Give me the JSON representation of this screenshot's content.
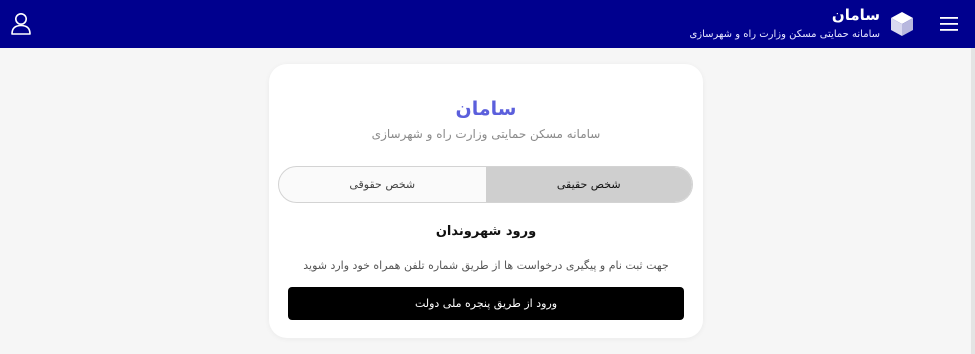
{
  "header": {
    "title": "سامان",
    "subtitle": "سامانه حمایتی مسکن وزارت راه و شهرسازی",
    "user_icon": "user-icon",
    "menu_icon": "hamburger-menu-icon",
    "logo_icon": "cube-logo-icon",
    "background_color": "#00008e"
  },
  "card": {
    "title": "سامان",
    "subtitle": "سامانه مسکن حمایتی وزارت راه و شهرسازی",
    "title_color": "#5b5fdc",
    "tabs": [
      {
        "label": "شخص حقوقی",
        "active": false
      },
      {
        "label": "شخص حقیقی",
        "active": true
      }
    ],
    "login_title": "ورود شهروندان",
    "login_description": "جهت ثبت نام و پیگیری درخواست ها از طریق شماره تلفن همراه خود وارد شوید",
    "login_button": "ورود از طریق پنجره ملی دولت"
  }
}
